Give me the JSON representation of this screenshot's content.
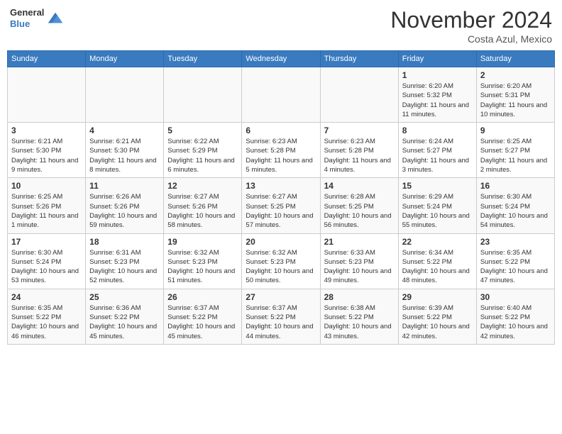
{
  "header": {
    "logo": {
      "general": "General",
      "blue": "Blue"
    },
    "title": "November 2024",
    "location": "Costa Azul, Mexico"
  },
  "calendar": {
    "weekdays": [
      "Sunday",
      "Monday",
      "Tuesday",
      "Wednesday",
      "Thursday",
      "Friday",
      "Saturday"
    ],
    "weeks": [
      [
        {
          "day": "",
          "info": ""
        },
        {
          "day": "",
          "info": ""
        },
        {
          "day": "",
          "info": ""
        },
        {
          "day": "",
          "info": ""
        },
        {
          "day": "",
          "info": ""
        },
        {
          "day": "1",
          "info": "Sunrise: 6:20 AM\nSunset: 5:32 PM\nDaylight: 11 hours and 11 minutes."
        },
        {
          "day": "2",
          "info": "Sunrise: 6:20 AM\nSunset: 5:31 PM\nDaylight: 11 hours and 10 minutes."
        }
      ],
      [
        {
          "day": "3",
          "info": "Sunrise: 6:21 AM\nSunset: 5:30 PM\nDaylight: 11 hours and 9 minutes."
        },
        {
          "day": "4",
          "info": "Sunrise: 6:21 AM\nSunset: 5:30 PM\nDaylight: 11 hours and 8 minutes."
        },
        {
          "day": "5",
          "info": "Sunrise: 6:22 AM\nSunset: 5:29 PM\nDaylight: 11 hours and 6 minutes."
        },
        {
          "day": "6",
          "info": "Sunrise: 6:23 AM\nSunset: 5:28 PM\nDaylight: 11 hours and 5 minutes."
        },
        {
          "day": "7",
          "info": "Sunrise: 6:23 AM\nSunset: 5:28 PM\nDaylight: 11 hours and 4 minutes."
        },
        {
          "day": "8",
          "info": "Sunrise: 6:24 AM\nSunset: 5:27 PM\nDaylight: 11 hours and 3 minutes."
        },
        {
          "day": "9",
          "info": "Sunrise: 6:25 AM\nSunset: 5:27 PM\nDaylight: 11 hours and 2 minutes."
        }
      ],
      [
        {
          "day": "10",
          "info": "Sunrise: 6:25 AM\nSunset: 5:26 PM\nDaylight: 11 hours and 1 minute."
        },
        {
          "day": "11",
          "info": "Sunrise: 6:26 AM\nSunset: 5:26 PM\nDaylight: 10 hours and 59 minutes."
        },
        {
          "day": "12",
          "info": "Sunrise: 6:27 AM\nSunset: 5:26 PM\nDaylight: 10 hours and 58 minutes."
        },
        {
          "day": "13",
          "info": "Sunrise: 6:27 AM\nSunset: 5:25 PM\nDaylight: 10 hours and 57 minutes."
        },
        {
          "day": "14",
          "info": "Sunrise: 6:28 AM\nSunset: 5:25 PM\nDaylight: 10 hours and 56 minutes."
        },
        {
          "day": "15",
          "info": "Sunrise: 6:29 AM\nSunset: 5:24 PM\nDaylight: 10 hours and 55 minutes."
        },
        {
          "day": "16",
          "info": "Sunrise: 6:30 AM\nSunset: 5:24 PM\nDaylight: 10 hours and 54 minutes."
        }
      ],
      [
        {
          "day": "17",
          "info": "Sunrise: 6:30 AM\nSunset: 5:24 PM\nDaylight: 10 hours and 53 minutes."
        },
        {
          "day": "18",
          "info": "Sunrise: 6:31 AM\nSunset: 5:23 PM\nDaylight: 10 hours and 52 minutes."
        },
        {
          "day": "19",
          "info": "Sunrise: 6:32 AM\nSunset: 5:23 PM\nDaylight: 10 hours and 51 minutes."
        },
        {
          "day": "20",
          "info": "Sunrise: 6:32 AM\nSunset: 5:23 PM\nDaylight: 10 hours and 50 minutes."
        },
        {
          "day": "21",
          "info": "Sunrise: 6:33 AM\nSunset: 5:23 PM\nDaylight: 10 hours and 49 minutes."
        },
        {
          "day": "22",
          "info": "Sunrise: 6:34 AM\nSunset: 5:22 PM\nDaylight: 10 hours and 48 minutes."
        },
        {
          "day": "23",
          "info": "Sunrise: 6:35 AM\nSunset: 5:22 PM\nDaylight: 10 hours and 47 minutes."
        }
      ],
      [
        {
          "day": "24",
          "info": "Sunrise: 6:35 AM\nSunset: 5:22 PM\nDaylight: 10 hours and 46 minutes."
        },
        {
          "day": "25",
          "info": "Sunrise: 6:36 AM\nSunset: 5:22 PM\nDaylight: 10 hours and 45 minutes."
        },
        {
          "day": "26",
          "info": "Sunrise: 6:37 AM\nSunset: 5:22 PM\nDaylight: 10 hours and 45 minutes."
        },
        {
          "day": "27",
          "info": "Sunrise: 6:37 AM\nSunset: 5:22 PM\nDaylight: 10 hours and 44 minutes."
        },
        {
          "day": "28",
          "info": "Sunrise: 6:38 AM\nSunset: 5:22 PM\nDaylight: 10 hours and 43 minutes."
        },
        {
          "day": "29",
          "info": "Sunrise: 6:39 AM\nSunset: 5:22 PM\nDaylight: 10 hours and 42 minutes."
        },
        {
          "day": "30",
          "info": "Sunrise: 6:40 AM\nSunset: 5:22 PM\nDaylight: 10 hours and 42 minutes."
        }
      ]
    ]
  }
}
